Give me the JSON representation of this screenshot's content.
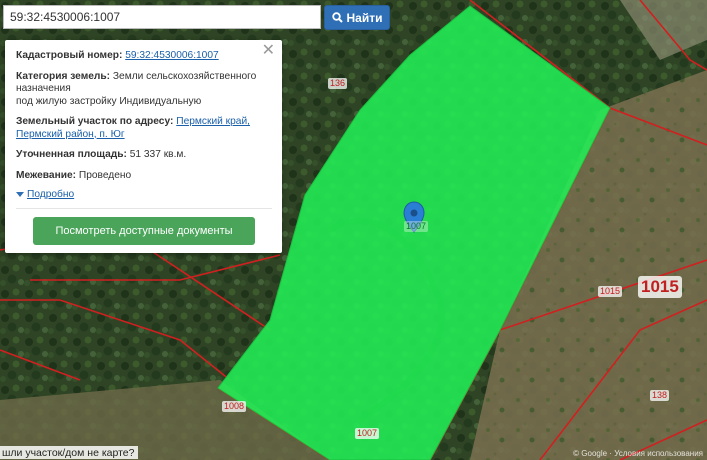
{
  "search": {
    "value": "59:32:4530006:1007",
    "button_label": "Найти"
  },
  "popup": {
    "cad_label": "Кадастровый номер:",
    "cad_value": "59:32:4530006:1007",
    "cat_label": "Категория земель:",
    "cat_value": "Земли сельскохозяйственного назначения",
    "cat_use": "под жилую застройку Индивидуальную",
    "addr_label": "Земельный участок по адресу:",
    "addr_value": "Пермский край, Пермский район, п. Юг",
    "area_label": "Уточненная площадь:",
    "area_value": "51 337 кв.м.",
    "survey_label": "Межевание:",
    "survey_value": "Проведено",
    "more_label": "Подробно",
    "docs_button": "Посмотреть доступные документы"
  },
  "map_labels": {
    "l136": "136",
    "l1015_small": "1015",
    "l1015_big": "1015",
    "l1008": "1008",
    "l1007_bottom": "1007",
    "l138": "138",
    "l1007_center": "1007"
  },
  "bottom_text": "шли участок/дом не карте?",
  "attribution": "© Google · Условия использования",
  "colors": {
    "parcel_fill": "#22ee55",
    "boundary": "#d02020",
    "button_blue": "#2f6fb5",
    "button_green": "#4aa45a"
  }
}
